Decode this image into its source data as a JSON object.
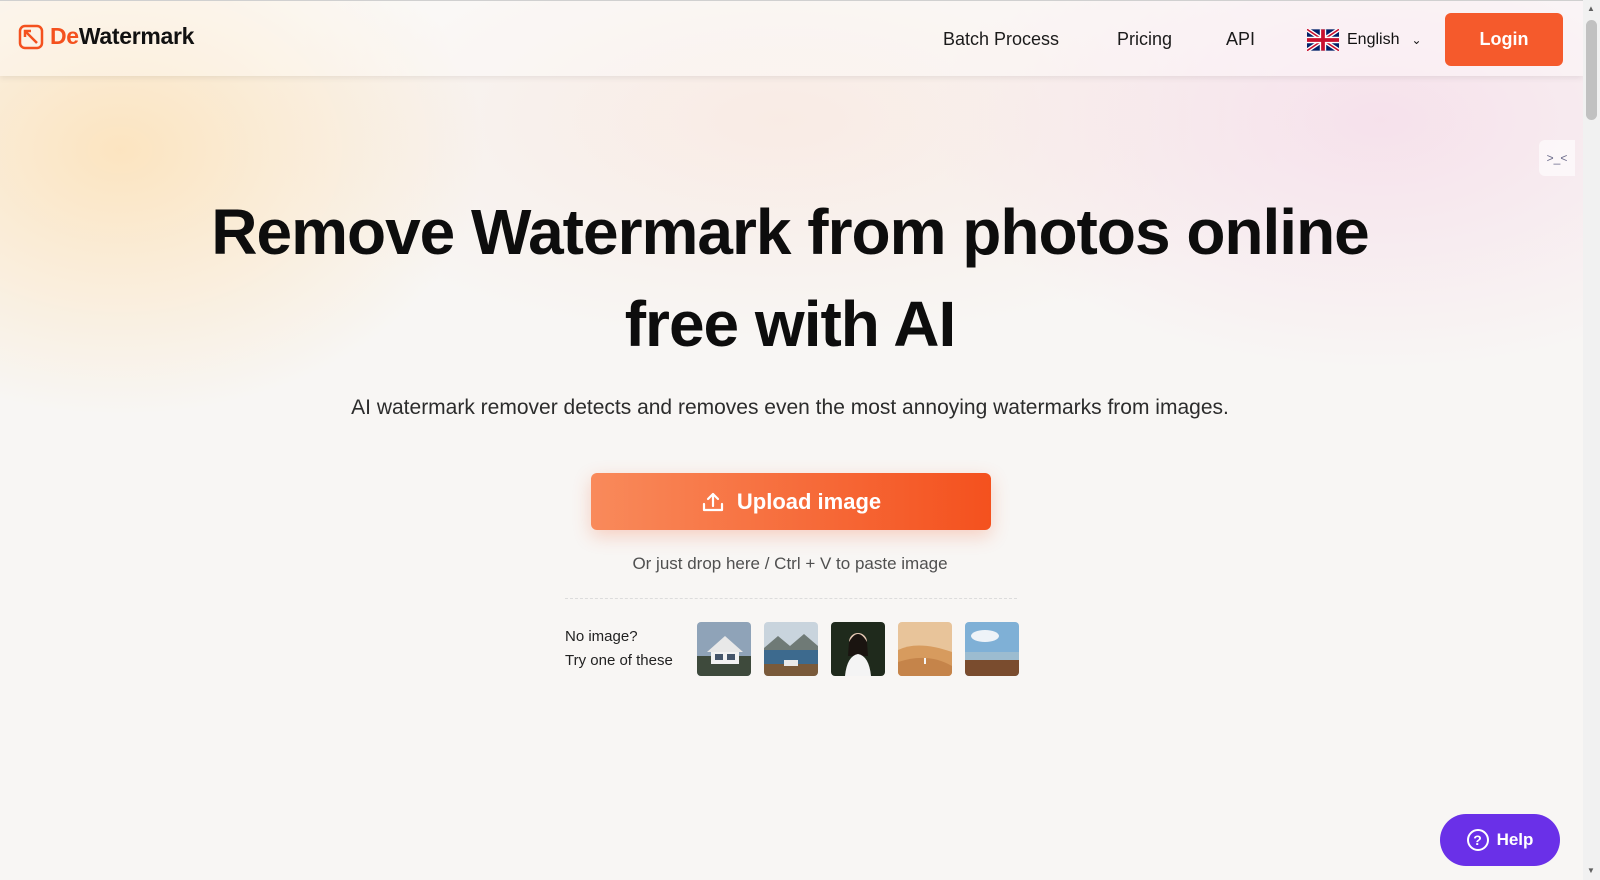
{
  "brand": {
    "logo_prefix": "De",
    "logo_suffix": "Watermark",
    "accent_color": "#f55a2c"
  },
  "nav": {
    "items": [
      "Batch Process",
      "Pricing",
      "API"
    ],
    "language": "English",
    "login_label": "Login"
  },
  "hero": {
    "title_line1": "Remove Watermark from photos online",
    "title_line2": "free with AI",
    "subtitle": "AI watermark remover detects and removes even the most annoying watermarks from images.",
    "upload_label": "Upload image",
    "drop_hint": "Or just drop here / Ctrl + V to paste image",
    "samples_line1": "No image?",
    "samples_line2": "Try one of these",
    "sample_thumbs": [
      "house-photo",
      "lake-photo",
      "portrait-photo",
      "desert-photo",
      "beach-photo"
    ]
  },
  "side_tab_glyph": ">_<",
  "help": {
    "label": "Help",
    "color": "#6a30e8"
  }
}
